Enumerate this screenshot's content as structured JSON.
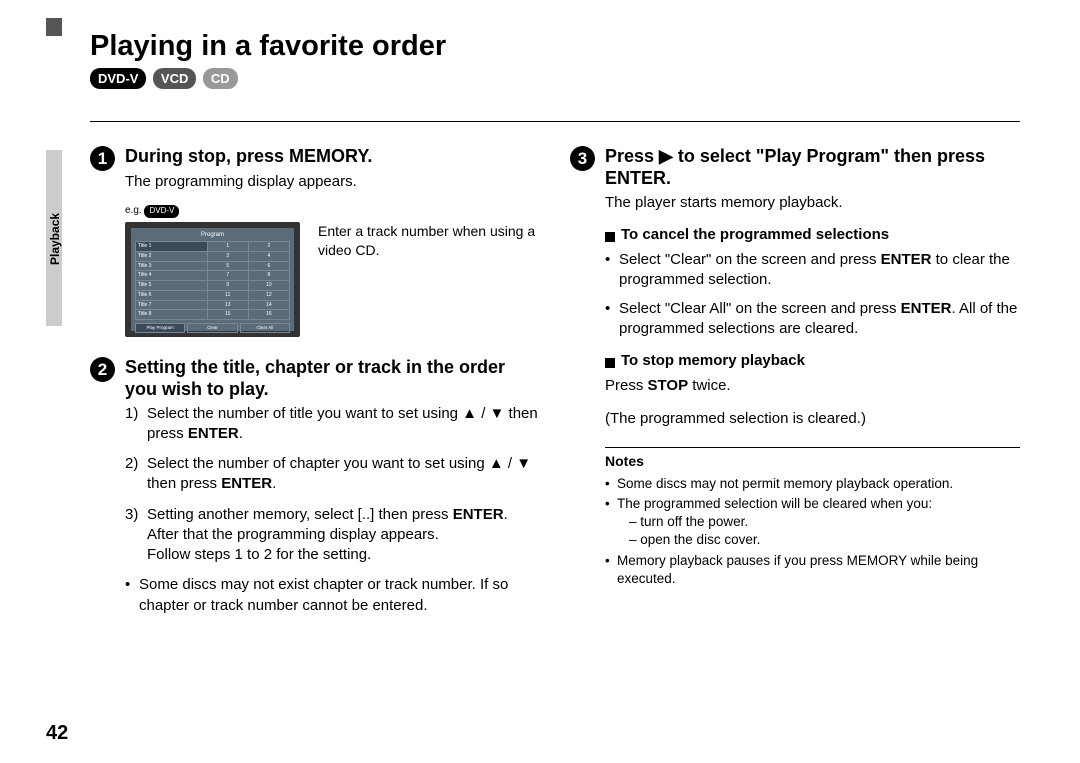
{
  "page": {
    "title": "Playing in a favorite order",
    "number": "42",
    "section_tab": "Playback",
    "badges": [
      "DVD-V",
      "VCD",
      "CD"
    ]
  },
  "step1": {
    "num": "1",
    "title": "During stop, press MEMORY.",
    "desc": "The programming display appears.",
    "eg": "e.g.",
    "eg_badge": "DVD-V",
    "caption": "Enter a track number when using a video CD.",
    "display": {
      "title": "Program",
      "rows": [
        [
          "Title 1",
          "1",
          "2"
        ],
        [
          "Title 2",
          "3",
          "4"
        ],
        [
          "Title 3",
          "5",
          "6"
        ],
        [
          "Title 4",
          "7",
          "8"
        ],
        [
          "Title 5",
          "9",
          "10"
        ],
        [
          "Title 6",
          "11",
          "12"
        ],
        [
          "Title 7",
          "13",
          "14"
        ],
        [
          "Title 8",
          "15",
          "16"
        ]
      ],
      "buttons": [
        "Play Program",
        "Clear",
        "Clear All"
      ]
    }
  },
  "step2": {
    "num": "2",
    "title": "Setting the title, chapter or track in the order you wish to play.",
    "items": {
      "i1n": "1)",
      "i1": "Select the number of title you want to set using ▲ / ▼ then press ",
      "i1b": "ENTER",
      "i1e": ".",
      "i2n": "2)",
      "i2": "Select the number of chapter you want to set using ▲ / ▼ then press ",
      "i2b": "ENTER",
      "i2e": ".",
      "i3n": "3)",
      "i3a": "Setting another memory, select [..] then press ",
      "i3b": "ENTER",
      "i3c": ". After that the programming display appears.",
      "i3d": "Follow steps 1 to 2 for the setting.",
      "ib": "Some discs may not exist chapter or track number. If so chapter or track number cannot be entered."
    }
  },
  "step3": {
    "num": "3",
    "title": "Press ▶ to select \"Play Program\" then press ENTER.",
    "desc": "The player starts memory playback.",
    "cancel_title": "To cancel the programmed selections",
    "cancel_b1a": "Select \"Clear\" on the screen and press ",
    "cancel_b1b": "ENTER",
    "cancel_b1c": " to clear the programmed selection.",
    "cancel_b2a": "Select \"Clear All\" on the screen and press ",
    "cancel_b2b": "ENTER",
    "cancel_b2c": ". All of the programmed selections are cleared.",
    "stop_title": "To stop memory playback",
    "stop_p1a": "Press ",
    "stop_p1b": "STOP",
    "stop_p1c": " twice.",
    "stop_p2": "(The programmed selection is cleared.)"
  },
  "notes": {
    "title": "Notes",
    "n1": "Some discs may not permit memory playback operation.",
    "n2": "The programmed selection will be cleared when you:",
    "n2a": "– turn off the power.",
    "n2b": "– open the disc cover.",
    "n3": "Memory playback pauses if you press MEMORY while being executed."
  }
}
